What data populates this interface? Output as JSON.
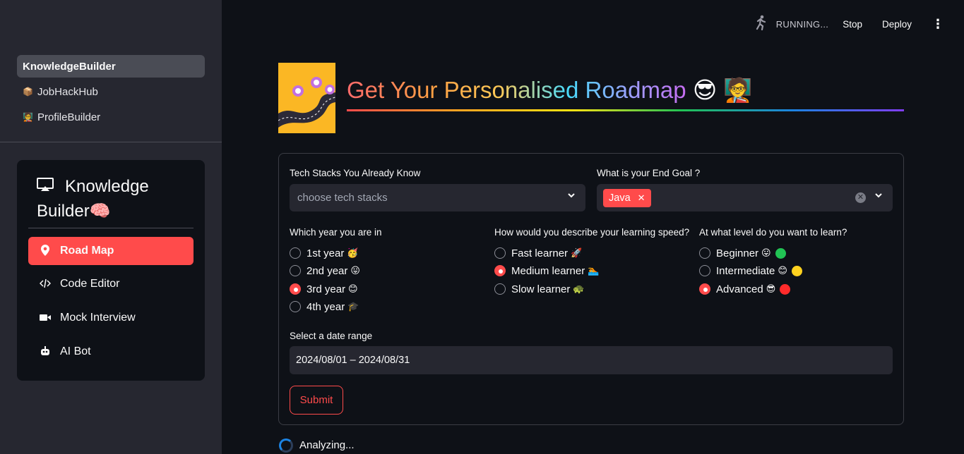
{
  "sidebar": {
    "pages": [
      {
        "label": "KnowledgeBuilder",
        "emoji": "",
        "active": true
      },
      {
        "label": "JobHackHub",
        "emoji": "📦",
        "active": false
      },
      {
        "label": "ProfileBuilder",
        "emoji": "🧑‍🏫",
        "active": false
      }
    ],
    "menu": {
      "title_line1": "Knowledge",
      "title_line2": "Builder🧠",
      "items": [
        {
          "label": "Road Map",
          "icon": "map-pin-icon",
          "glyph": "📍",
          "active": true
        },
        {
          "label": "Code Editor",
          "icon": "code-icon",
          "glyph": "</>",
          "active": false
        },
        {
          "label": "Mock Interview",
          "icon": "video-camera-icon",
          "glyph": "■",
          "active": false
        },
        {
          "label": "AI Bot",
          "icon": "robot-icon",
          "glyph": "🤖",
          "active": false
        }
      ]
    }
  },
  "toolbar": {
    "status": "RUNNING...",
    "stop_label": "Stop",
    "deploy_label": "Deploy",
    "menu_glyph": "⋮"
  },
  "header": {
    "title": "Get Your Personalised Roadmap",
    "title_emoji": "😎 🧑‍🏫"
  },
  "form": {
    "tech_stacks": {
      "label": "Tech Stacks You Already Know",
      "placeholder": "choose tech stacks"
    },
    "end_goal": {
      "label": "What is your End Goal ?",
      "selected_tag": "Java"
    },
    "year": {
      "label": "Which year you are in",
      "options": [
        {
          "label": "1st year",
          "emoji": "🥳",
          "checked": false
        },
        {
          "label": "2nd year",
          "emoji": "😛",
          "checked": false
        },
        {
          "label": "3rd year",
          "emoji": "😊",
          "checked": true
        },
        {
          "label": "4th year",
          "emoji": "🎓",
          "checked": false
        }
      ]
    },
    "speed": {
      "label": "How would you describe your learning speed?",
      "options": [
        {
          "label": "Fast learner",
          "emoji": "🚀",
          "checked": false
        },
        {
          "label": "Medium learner",
          "emoji": "🏊",
          "checked": true
        },
        {
          "label": "Slow learner",
          "emoji": "🐢",
          "checked": false
        }
      ]
    },
    "level": {
      "label": "At what level do you want to learn?",
      "options": [
        {
          "label": "Beginner",
          "emoji": "😛",
          "dot_color": "#21c354",
          "checked": false
        },
        {
          "label": "Intermediate",
          "emoji": "😊",
          "dot_color": "#ffd21f",
          "checked": false
        },
        {
          "label": "Advanced",
          "emoji": "😎",
          "dot_color": "#ff2b2b",
          "checked": true
        }
      ]
    },
    "date": {
      "label": "Select a date range",
      "value": "2024/08/01 – 2024/08/31"
    },
    "submit_label": "Submit"
  },
  "status_text": "Analyzing...",
  "colors": {
    "accent": "#ff4b4b",
    "background": "#0e1117",
    "sidebar": "#262730"
  }
}
